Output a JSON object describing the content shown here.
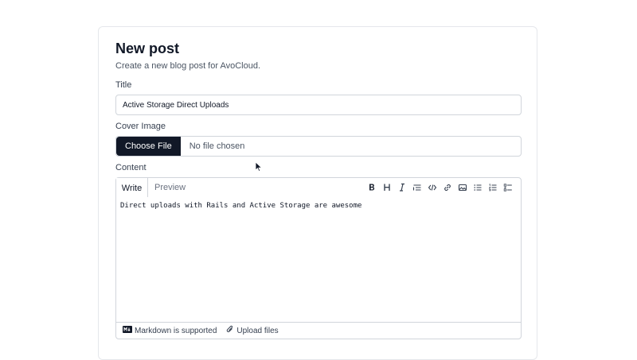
{
  "form": {
    "title": "New post",
    "subtitle": "Create a new blog post for AvoCloud.",
    "title_label": "Title",
    "title_value": "Active Storage Direct Uploads",
    "cover_label": "Cover Image",
    "choose_file_label": "Choose File",
    "file_status": "No file chosen",
    "content_label": "Content"
  },
  "editor": {
    "tabs": [
      {
        "label": "Write",
        "active": true
      },
      {
        "label": "Preview",
        "active": false
      }
    ],
    "toolbar_icons": [
      "bold-icon",
      "heading-icon",
      "italic-icon",
      "quote-icon",
      "code-icon",
      "link-icon",
      "image-icon",
      "bullet-list-icon",
      "numbered-list-icon",
      "task-list-icon"
    ],
    "content": "Direct uploads with Rails and Active Storage are awesome",
    "footer": {
      "markdown_text": "Markdown is supported",
      "upload_text": "Upload files"
    }
  },
  "colors": {
    "primary_button": "#111827",
    "border": "#d1d5db"
  }
}
